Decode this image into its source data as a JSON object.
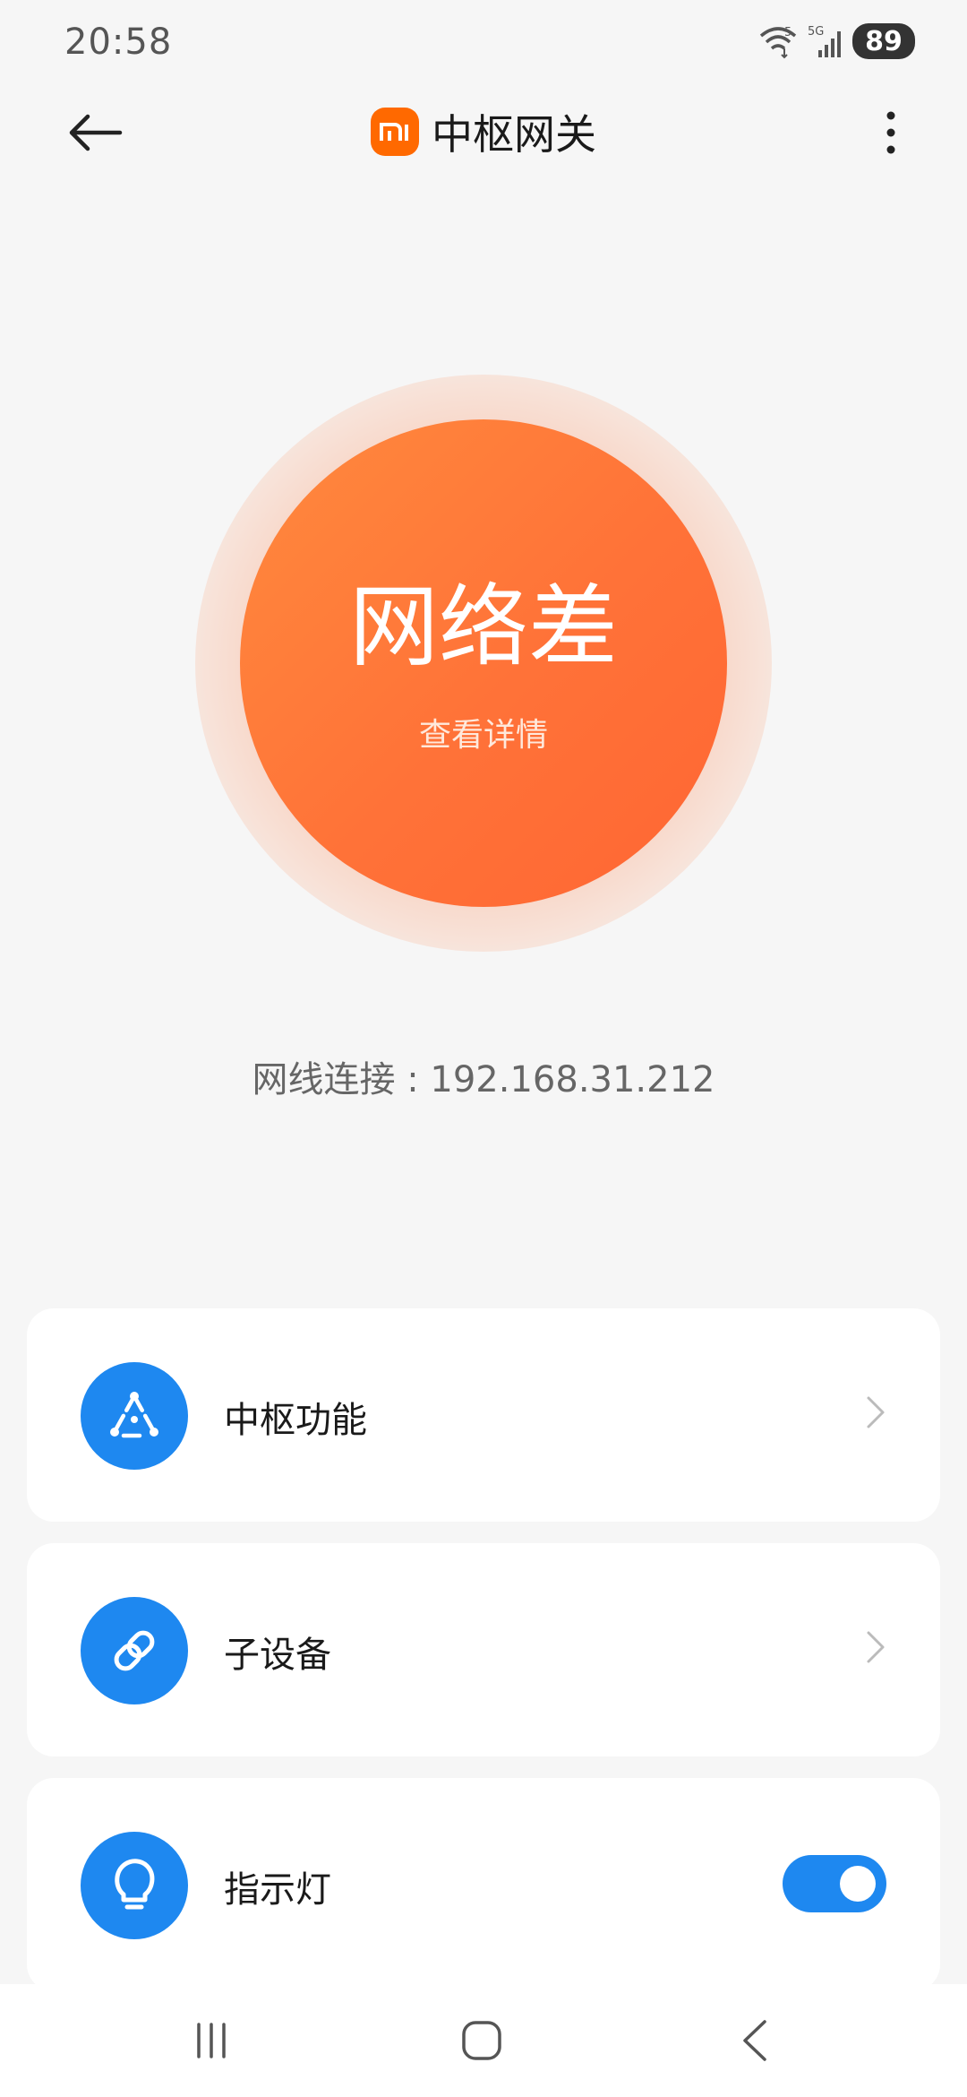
{
  "status_bar": {
    "time": "20:58",
    "wifi_badge": "5",
    "cell_badge": "5G",
    "battery": "89"
  },
  "header": {
    "title": "中枢网关",
    "logo_text": "mi",
    "brand_color": "#ff6900",
    "icons": [
      "back-arrow-icon",
      "mi-logo-icon",
      "more-vertical-icon"
    ]
  },
  "status": {
    "label": "网络差",
    "details_link": "查看详情",
    "color": "#ff7238"
  },
  "connection": {
    "text": "网线连接 : 192.168.31.212"
  },
  "cards": [
    {
      "label": "中枢功能",
      "icon": "hub-triangle-icon",
      "trailing": "chevron-right-icon"
    },
    {
      "label": "子设备",
      "icon": "link-icon",
      "trailing": "chevron-right-icon"
    },
    {
      "label": "指示灯",
      "icon": "lightbulb-icon",
      "trailing": "toggle",
      "toggle_on": true
    }
  ],
  "accent_color": "#1e88f0",
  "nav_bar": {
    "icons": [
      "recent-apps-icon",
      "home-icon",
      "back-nav-icon"
    ]
  }
}
